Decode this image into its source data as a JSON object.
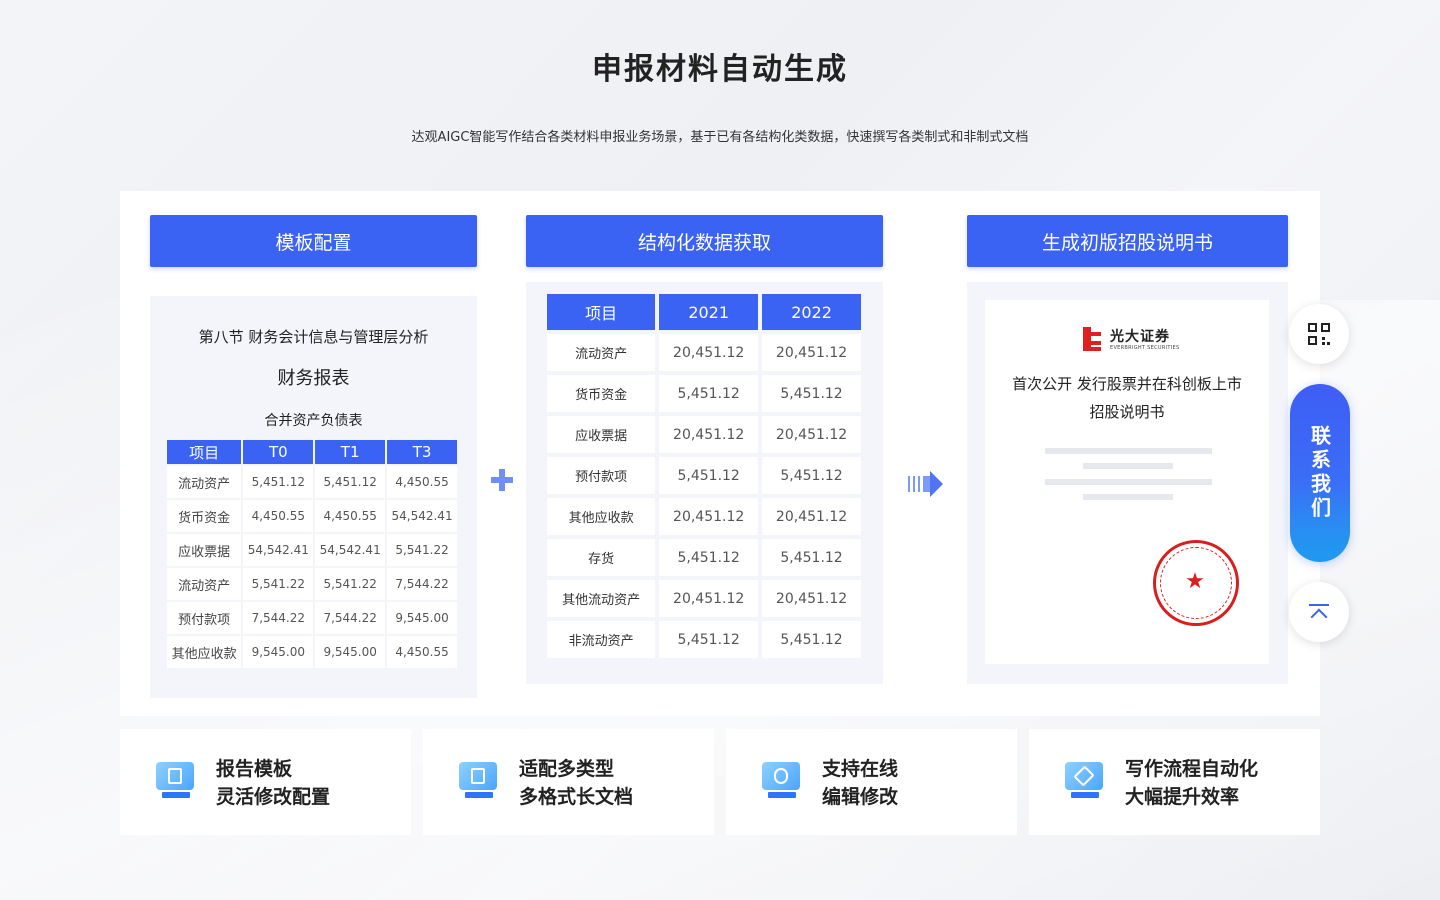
{
  "header": {
    "title": "申报材料自动生成",
    "subtitle": "达观AIGC智能写作结合各类材料申报业务场景，基于已有各结构化类数据，快速撰写各类制式和非制式文档"
  },
  "columns": {
    "template": "模板配置",
    "data": "结构化数据获取",
    "output": "生成初版招股说明书"
  },
  "template_card": {
    "section": "第八节 财务会计信息与管理层分析",
    "report": "财务报表",
    "table_title": "合并资产负债表",
    "headers": [
      "项目",
      "T0",
      "T1",
      "T3"
    ],
    "rows": [
      [
        "流动资产",
        "5,451.12",
        "5,451.12",
        "4,450.55"
      ],
      [
        "货币资金",
        "4,450.55",
        "4,450.55",
        "54,542.41"
      ],
      [
        "应收票据",
        "54,542.41",
        "54,542.41",
        "5,541.22"
      ],
      [
        "流动资产",
        "5,541.22",
        "5,541.22",
        "7,544.22"
      ],
      [
        "预付款项",
        "7,544.22",
        "7,544.22",
        "9,545.00"
      ],
      [
        "其他应收款",
        "9,545.00",
        "9,545.00",
        "4,450.55"
      ]
    ]
  },
  "data_card": {
    "headers": [
      "项目",
      "2021",
      "2022"
    ],
    "rows": [
      [
        "流动资产",
        "20,451.12",
        "20,451.12"
      ],
      [
        "货币资金",
        "5,451.12",
        "5,451.12"
      ],
      [
        "应收票据",
        "20,451.12",
        "20,451.12"
      ],
      [
        "预付款项",
        "5,451.12",
        "5,451.12"
      ],
      [
        "其他应收款",
        "20,451.12",
        "20,451.12"
      ],
      [
        "存货",
        "5,451.12",
        "5,451.12"
      ],
      [
        "其他流动资产",
        "20,451.12",
        "20,451.12"
      ],
      [
        "非流动资产",
        "5,451.12",
        "5,451.12"
      ]
    ]
  },
  "doc_card": {
    "logo_name": "光大证券",
    "logo_sub": "EVERBRIGHT SECURITIES",
    "title_line1": "首次公开 发行股票并在科创板上市",
    "title_line2": "招股说明书",
    "seal_star": "★"
  },
  "features": [
    {
      "line1": "报告模板",
      "line2": "灵活修改配置",
      "icon": "template-icon"
    },
    {
      "line1": "适配多类型",
      "line2": "多格式长文档",
      "icon": "word-doc-icon"
    },
    {
      "line1": "支持在线",
      "line2": "编辑修改",
      "icon": "cloud-edit-icon"
    },
    {
      "line1": "写作流程自动化",
      "line2": "大幅提升效率",
      "icon": "rocket-icon"
    }
  ],
  "sidebar": {
    "contact": "联系我们"
  },
  "colors": {
    "accent": "#3b63f3",
    "seal": "#d81e1e"
  }
}
